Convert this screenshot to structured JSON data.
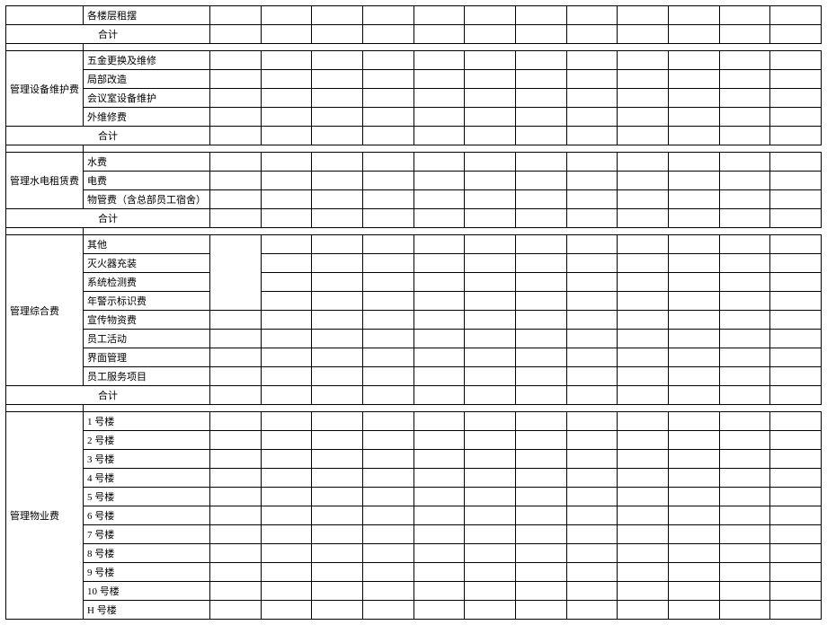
{
  "sections": [
    {
      "category": "",
      "category_blank_lead": true,
      "items": [
        "各楼层租摆"
      ],
      "subtotal": "合计",
      "gap_after": true
    },
    {
      "category": "管理设备维护费",
      "items": [
        "五金更换及维修",
        "局部改造",
        "会议室设备维护",
        "外维修费"
      ],
      "subtotal": "合计",
      "gap_after": true
    },
    {
      "category": "管理水电租赁费",
      "items": [
        "水费",
        "电费",
        "物管费（含总部员工宿舍）"
      ],
      "subtotal": "合计",
      "gap_after": true
    },
    {
      "category": "管理综合费",
      "items": [
        "其他",
        "灭火器充装",
        "系统检测费",
        "年警示标识费",
        "宣传物资费",
        "员工活动",
        "界面管理",
        "员工服务项目"
      ],
      "merge_data_first_col_rows": 4,
      "subtotal": "合计",
      "gap_after": true
    },
    {
      "category": "管理物业费",
      "items": [
        "1 号楼",
        "2 号楼",
        "3 号楼",
        "4 号楼",
        "5 号楼",
        "6 号楼",
        "7 号楼",
        "8 号楼",
        "9 号楼",
        "10 号楼",
        "H 号楼"
      ],
      "subtotal": null,
      "gap_after": false
    }
  ],
  "data_columns": 12
}
